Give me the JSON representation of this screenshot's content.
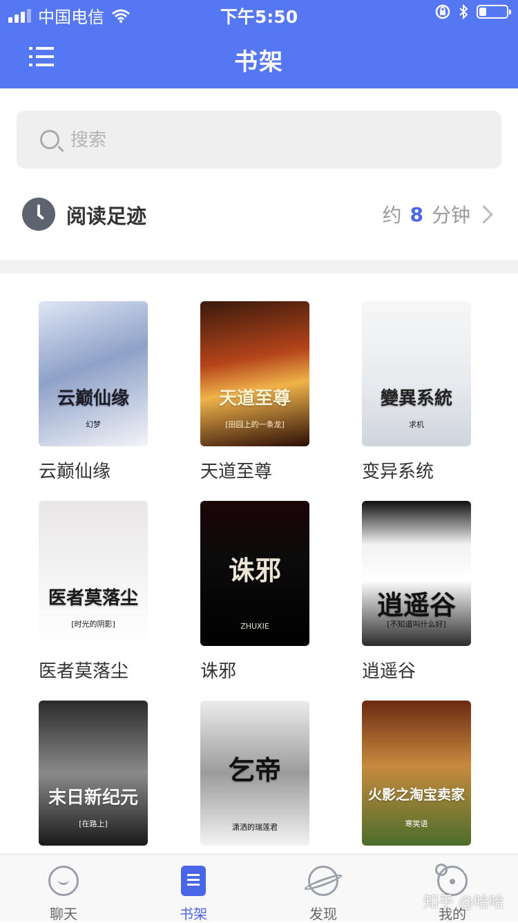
{
  "status_bar": {
    "carrier": "中国电信",
    "time": "下午5:50",
    "battery_level": 0.25
  },
  "nav": {
    "title": "书架",
    "menu_icon": "menu-icon"
  },
  "search": {
    "placeholder": "搜索",
    "value": ""
  },
  "history": {
    "label": "阅读足迹",
    "prefix": "约",
    "minutes": "8",
    "suffix": "分钟"
  },
  "books": [
    {
      "title": "云巅仙缘",
      "cover_title": "云巅仙缘",
      "cover_author": "幻梦",
      "bg": "linear-gradient(160deg,#dfe6f5 0%,#8ea1c8 45%,#f3f4f8 100%)",
      "fg": "#1c1c2a"
    },
    {
      "title": "天道至尊",
      "cover_title": "天道至尊",
      "cover_author": "[田园上的一条龙]",
      "bg": "linear-gradient(170deg,#3a1a0c 0%,#b5441a 40%,#f0b34a 60%,#2a0d06 100%)",
      "fg": "#fff2d0"
    },
    {
      "title": "变异系统",
      "cover_title": "變異系統",
      "cover_author": "求机",
      "bg": "linear-gradient(180deg,#f7f7f7 0%,#e8ebef 55%,#cfd5dc 100%)",
      "fg": "#222"
    },
    {
      "title": "医者莫落尘",
      "cover_title": "医者莫落尘",
      "cover_author": "[时光的阴影]",
      "bg": "linear-gradient(180deg,#e9e6e6 0%,#f6f6f6 60%,#ffffff 100%)",
      "fg": "#1a1a1a"
    },
    {
      "title": "诛邪",
      "cover_title": "诛邪",
      "cover_author": "ZHUXIE",
      "bg": "linear-gradient(180deg,#1a0508 0%,#0b0b0b 40%,#000 100%)",
      "fg": "#ece4d6"
    },
    {
      "title": "逍遥谷",
      "cover_title": "逍遥谷",
      "cover_author": "[不知道叫什么好]",
      "bg": "linear-gradient(180deg,#0f0f0f 0%,#f2f2f2 30%,#ffffff 55%,#2b2b2b 100%)",
      "fg": "#111"
    },
    {
      "title": "末日新纪元",
      "cover_title": "末日新纪元",
      "cover_author": "[在路上]",
      "bg": "linear-gradient(180deg,#2b2b2b 0%,#8a8a8a 50%,#1a1a1a 100%)",
      "fg": "#f5f5f5"
    },
    {
      "title": "乞帝",
      "cover_title": "乞帝",
      "cover_author": "潇洒的瑞莲君",
      "bg": "linear-gradient(180deg,#ececec 0%,#9b9b9b 50%,#f3f3f3 100%)",
      "fg": "#111"
    },
    {
      "title": "火影之淘宝卖家",
      "cover_title": "火影之淘宝卖家",
      "cover_author": "寒笑语",
      "bg": "linear-gradient(180deg,#6b2a12 0%,#c88a3e 45%,#4b6d2a 100%)",
      "fg": "#ffffff"
    }
  ],
  "tabs": [
    {
      "label": "聊天",
      "icon": "chat-icon",
      "active": false
    },
    {
      "label": "书架",
      "icon": "bookshelf-icon",
      "active": true
    },
    {
      "label": "发现",
      "icon": "planet-icon",
      "active": false
    },
    {
      "label": "我的",
      "icon": "bear-icon",
      "active": false
    }
  ],
  "watermark": "知乎 @哈哈",
  "colors": {
    "accent": "#5677f2",
    "active_tab": "#4a66e8",
    "minutes_highlight": "#4a66e8"
  }
}
